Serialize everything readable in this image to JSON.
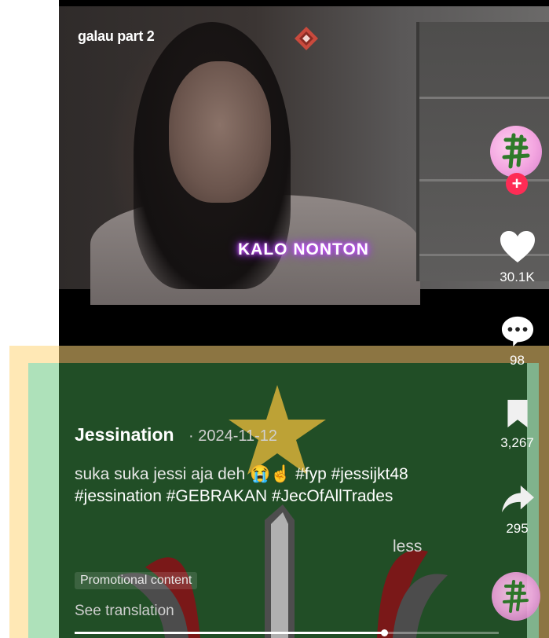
{
  "video": {
    "title": "galau part 2",
    "overlay_text": "KALO NONTON"
  },
  "caption": {
    "username": "Jessination",
    "date": "· 2024-11-12",
    "text": "suka suka jessi aja deh 😭☝️",
    "tags": " #fyp #jessijkt48 #jessination #GEBRAKAN #JecOfAllTrades",
    "less_label": "less",
    "promo_label": "Promotional content",
    "see_translation": "See translation"
  },
  "actions": {
    "likes": "30.1K",
    "comments": "98",
    "saves": "3,267",
    "shares": "295",
    "follow_symbol": "+"
  },
  "progress": {
    "fraction": 0.73
  },
  "colors": {
    "follow_red": "#fe2c55",
    "neon_glow": "#b03cff"
  }
}
